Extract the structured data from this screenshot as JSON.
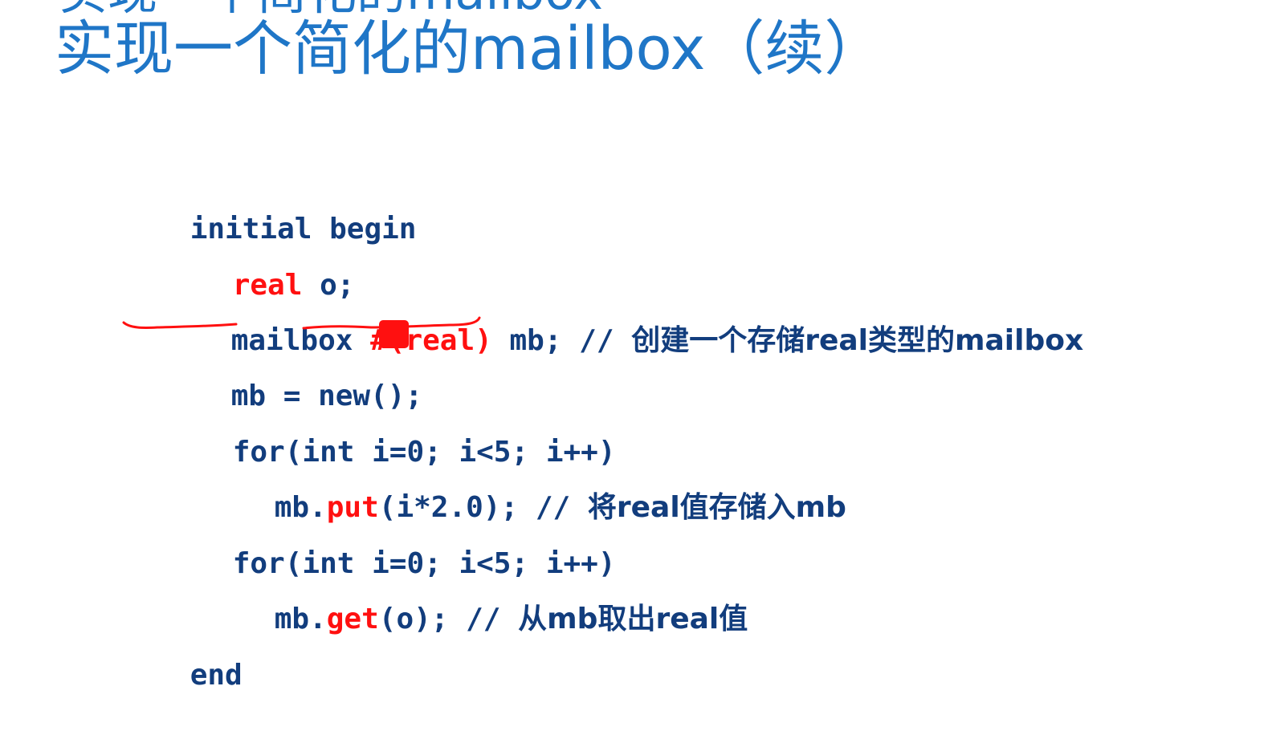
{
  "header": {
    "title_partial": "实现一个简化的mailbox",
    "title": "实现一个简化的mailbox（续）"
  },
  "code": {
    "lines": [
      {
        "parts": [
          {
            "text": "initial begin"
          }
        ]
      },
      {
        "parts": [
          {
            "text": "real"
          },
          {
            "text": " o;"
          }
        ]
      },
      {
        "parts": [
          {
            "text": "mailbox "
          },
          {
            "text": "#(real)"
          },
          {
            "text": " mb; // "
          },
          {
            "text": "创建一个存储real类型的mailbox"
          }
        ]
      },
      {
        "parts": [
          {
            "text": "mb = new();"
          }
        ]
      },
      {
        "parts": [
          {
            "text": "for(int i=0; i<5; i++)"
          }
        ]
      },
      {
        "parts": [
          {
            "text": "mb."
          },
          {
            "text": "put"
          },
          {
            "text": "(i*2.0); // "
          },
          {
            "text": "将real值存储入mb"
          }
        ]
      },
      {
        "parts": [
          {
            "text": "for(int i=0; i<5; i++)"
          }
        ]
      },
      {
        "parts": [
          {
            "text": "mb."
          },
          {
            "text": "get"
          },
          {
            "text": "(o); // "
          },
          {
            "text": "从mb取出real值"
          }
        ]
      },
      {
        "parts": [
          {
            "text": "end"
          }
        ]
      }
    ]
  },
  "colors": {
    "title": "#1f76c7",
    "code": "#123d7d",
    "keyword_highlight": "#ff1010",
    "annotation": "#ff1010"
  }
}
